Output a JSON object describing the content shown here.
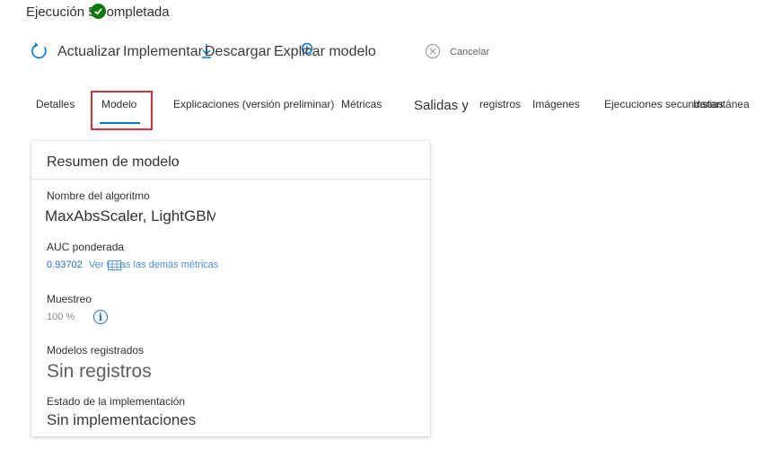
{
  "header": {
    "run_title_prefix": "Ejecución 5",
    "run_title_suffix": "ompletada"
  },
  "toolbar": {
    "refresh_label": "Actualizar",
    "deploy_label": "Implementar",
    "download_label": "Descargar",
    "explain_label": "Explicar modelo",
    "cancel_label": "Cancelar"
  },
  "tabs": [
    {
      "label": "Detalles"
    },
    {
      "label": "Modelo"
    },
    {
      "label": "Explicaciones (versión preliminar)"
    },
    {
      "label": "Métricas"
    },
    {
      "label": "Salidas y"
    },
    {
      "label": "registros"
    },
    {
      "label": "Imágenes"
    },
    {
      "label": "Ejecuciones secundarias"
    },
    {
      "label": "Instantánea"
    }
  ],
  "model_summary": {
    "title": "Resumen de modelo",
    "algorithm_label": "Nombre del algoritmo",
    "algorithm_value": "MaxAbsScaler, LightGBM",
    "auc_label": "AUC ponderada",
    "auc_value": "0.93702",
    "auc_link": "Ver todas las demás métricas",
    "sampling_label": "Muestreo",
    "sampling_value": "100 %",
    "registered_label": "Modelos registrados",
    "registered_value": "Sin registros",
    "deploy_status_label": "Estado de la implementación",
    "deploy_status_value": "Sin implementaciones"
  },
  "colors": {
    "accent": "#0078d4",
    "link": "#1f6ec7",
    "success": "#0b7a0b",
    "highlight": "#d13438"
  }
}
